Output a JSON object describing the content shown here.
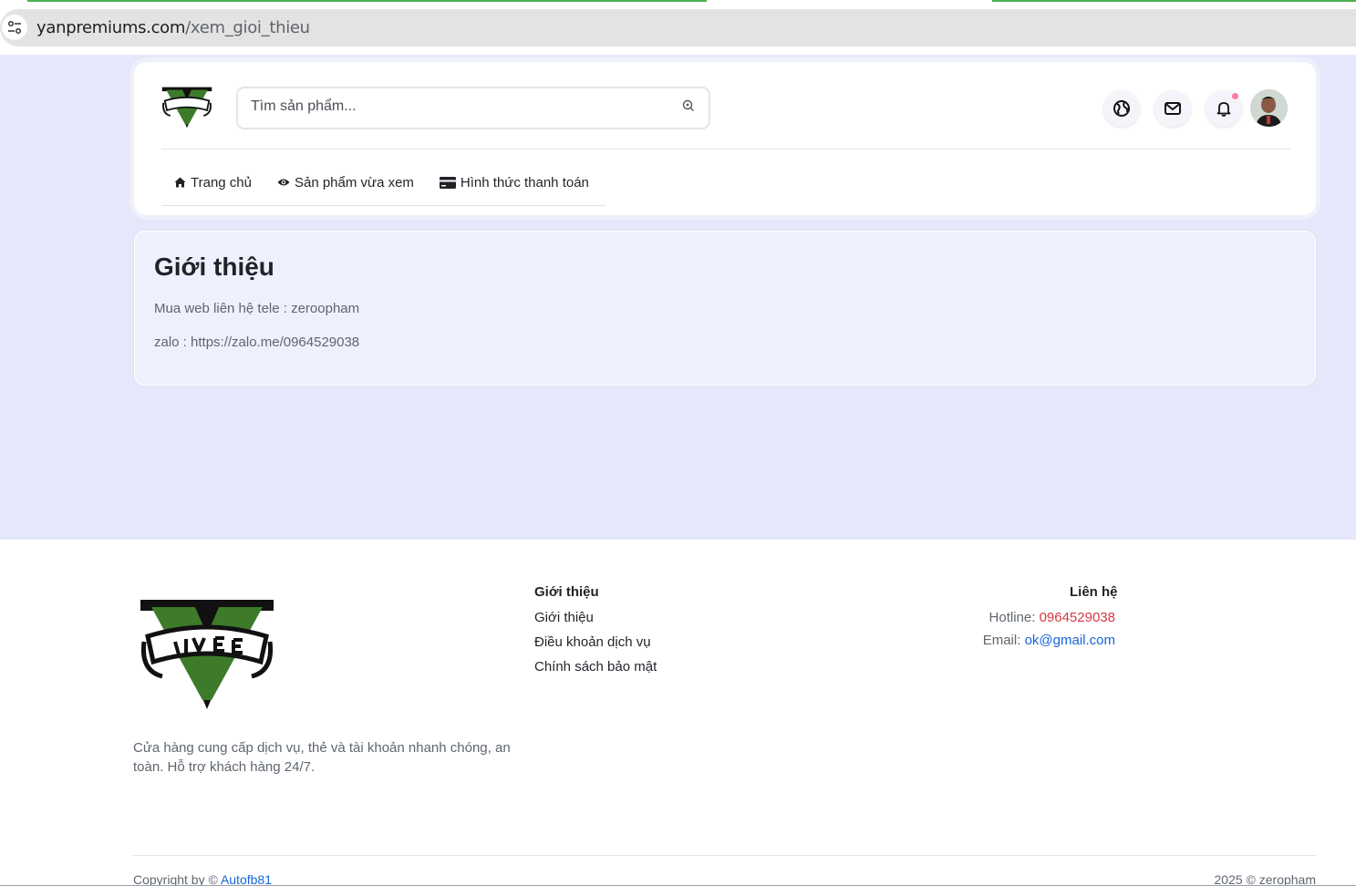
{
  "browser": {
    "url_host": "yanpremiums.com",
    "url_path": "/xem_gioi_thieu"
  },
  "header": {
    "search": {
      "placeholder": "Tìm sản phẩm..."
    },
    "nav": [
      {
        "label": "Trang chủ",
        "icon": "home-icon"
      },
      {
        "label": "Sản phẩm vừa xem",
        "icon": "eye-icon"
      },
      {
        "label": "Hình thức thanh toán",
        "icon": "credit-card-icon"
      }
    ],
    "icons": [
      "globe-icon",
      "mail-icon",
      "bell-icon"
    ]
  },
  "intro": {
    "title": "Giới thiệu",
    "lines": [
      "Mua web liên hệ tele : zeroopham",
      "zalo : https://zalo.me/0964529038"
    ]
  },
  "footer": {
    "description": "Cửa hàng cung cấp dịch vụ, thẻ và tài khoản nhanh chóng, an toàn. Hỗ trợ khách hàng 24/7.",
    "about": {
      "title": "Giới thiệu",
      "links": [
        "Giới thiệu",
        "Điều khoản dịch vụ",
        "Chính sách bảo mật"
      ]
    },
    "contact": {
      "title": "Liên hệ",
      "hotline_label": "Hotline:",
      "hotline": "0964529038",
      "email_label": "Email:",
      "email": "ok@gmail.com"
    },
    "copyright_prefix": "Copyright by ©",
    "copyright_link": "Autofb81",
    "copyright_right": "2025 © zeropham"
  },
  "colors": {
    "page_bg": "#e5e8fa",
    "intro_bg": "#eef1fd",
    "hotline": "#d63842",
    "link": "#1565d8",
    "logo_green": "#3d7a2a"
  }
}
